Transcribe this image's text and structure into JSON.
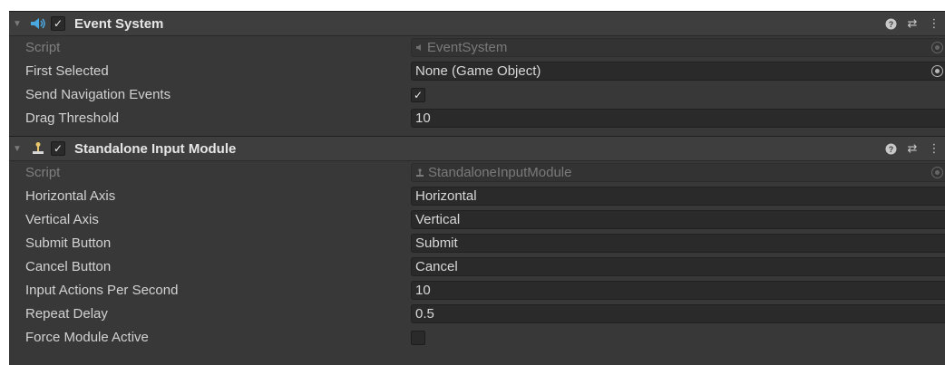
{
  "event_system": {
    "title": "Event System",
    "enabled_check": "✓",
    "help_glyph": "?",
    "settings_glyph": "⇄",
    "menu_glyph": "⋮",
    "fields": {
      "script": {
        "label": "Script",
        "value": "EventSystem"
      },
      "first_selected": {
        "label": "First Selected",
        "value": "None (Game Object)"
      },
      "send_navigation": {
        "label": "Send Navigation Events",
        "check": "✓"
      },
      "drag_threshold": {
        "label": "Drag Threshold",
        "value": "10"
      }
    }
  },
  "standalone_input": {
    "title": "Standalone Input Module",
    "enabled_check": "✓",
    "help_glyph": "?",
    "settings_glyph": "⇄",
    "menu_glyph": "⋮",
    "fields": {
      "script": {
        "label": "Script",
        "value": "StandaloneInputModule"
      },
      "horizontal_axis": {
        "label": "Horizontal Axis",
        "value": "Horizontal"
      },
      "vertical_axis": {
        "label": "Vertical Axis",
        "value": "Vertical"
      },
      "submit_button": {
        "label": "Submit Button",
        "value": "Submit"
      },
      "cancel_button": {
        "label": "Cancel Button",
        "value": "Cancel"
      },
      "input_actions": {
        "label": "Input Actions Per Second",
        "value": "10"
      },
      "repeat_delay": {
        "label": "Repeat Delay",
        "value": "0.5"
      },
      "force_module": {
        "label": "Force Module Active",
        "check": ""
      }
    }
  },
  "colors": {
    "panel_bg": "#383838",
    "header_bg": "#3e3e3e",
    "field_bg": "#2a2a2a",
    "event_icon": "#4aa8e0",
    "input_icon": "#e8c46a"
  }
}
